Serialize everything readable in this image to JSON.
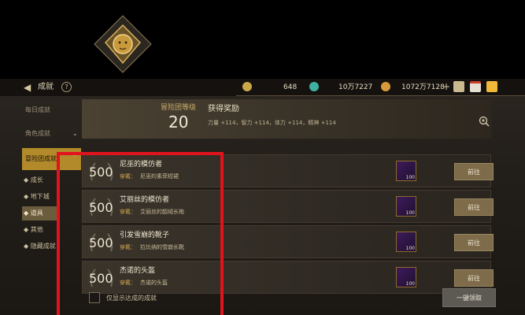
{
  "topbar": {
    "title": "成就",
    "help": "?",
    "currency1": "648",
    "currency2": "10万7227",
    "currency3": "1072万7128",
    "plus": "+"
  },
  "sidebar": {
    "tabs": [
      "每日成就",
      "角色成就",
      "冒险团成就"
    ],
    "subs": [
      "成长",
      "地下城",
      "道具",
      "其他",
      "隐藏成就"
    ],
    "active_tab": "冒险团成就",
    "active_sub": "道具"
  },
  "header": {
    "level_label": "冒险团等级",
    "level": "20",
    "reward_title": "获得奖励",
    "reward_attrs": "力量 +114，智力 +114，体力 +114，精神 +114"
  },
  "rows": [
    {
      "points": "500",
      "name": "尼巫的模仿者",
      "key": "穿戴：",
      "desc": "尼巫的素菲短裙",
      "qty": "100",
      "btn": "前往"
    },
    {
      "points": "500",
      "name": "艾丽丝的模仿者",
      "key": "穿戴：",
      "desc": "艾丽丝的韶绒长袍",
      "qty": "100",
      "btn": "前往"
    },
    {
      "points": "500",
      "name": "引发雪崩的靴子",
      "key": "穿戴：",
      "desc": "拉比纳的雪崩长靴",
      "qty": "100",
      "btn": "前往"
    },
    {
      "points": "500",
      "name": "杰诺的头盔",
      "key": "穿戴：",
      "desc": "杰诺的头盔",
      "qty": "100",
      "btn": "前往"
    }
  ],
  "footer": {
    "checkbox_label": "仅显示达成的成就",
    "claim_all": "一键领取"
  },
  "colors": {
    "accent_gold": "#b28a2a",
    "highlight_red": "#e1141e",
    "button": "#7d6b4a"
  }
}
